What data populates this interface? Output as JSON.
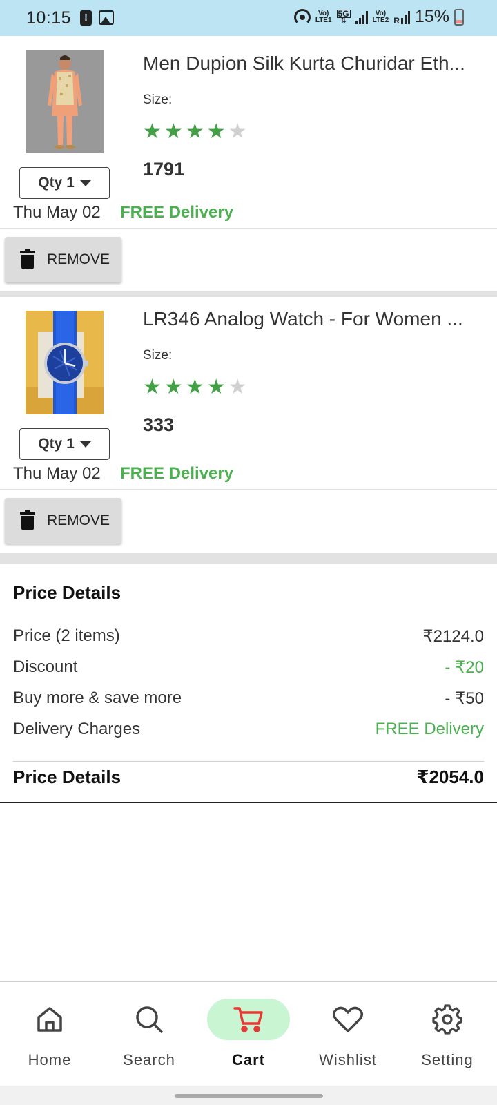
{
  "status_bar": {
    "time": "10:15",
    "battery_pct": "15%",
    "net_5g": "5G",
    "volte1_top": "Vo)",
    "volte1_bottom": "LTE1",
    "volte2_top": "Vo)",
    "volte2_bottom": "LTE2",
    "roam": "R",
    "icons": [
      "alert-icon",
      "image-icon",
      "hotspot-icon",
      "signal-icon",
      "battery-icon"
    ]
  },
  "cart_items": [
    {
      "title": "Men Dupion Silk Kurta Churidar Eth...",
      "size_label": "Size:",
      "rating": 4,
      "rating_max": 5,
      "price": "1791",
      "qty_label": "Qty 1",
      "delivery_date": "Thu May 02",
      "delivery_text": "FREE Delivery",
      "remove_label": "REMOVE"
    },
    {
      "title": "LR346 Analog Watch - For Women ...",
      "size_label": "Size:",
      "rating": 4,
      "rating_max": 5,
      "price": "333",
      "qty_label": "Qty 1",
      "delivery_date": "Thu May 02",
      "delivery_text": "FREE Delivery",
      "remove_label": "REMOVE"
    }
  ],
  "price_details": {
    "heading": "Price Details",
    "rows": [
      {
        "label": "Price (2 items)",
        "value": "₹2124.0"
      },
      {
        "label": "Discount",
        "value": "- ₹20"
      },
      {
        "label": "Buy more & save more",
        "value": "- ₹50"
      },
      {
        "label": "Delivery Charges",
        "value": "FREE Delivery"
      }
    ],
    "total_label": "Price Details",
    "total_value": "₹2054.0"
  },
  "bottom_nav": {
    "items": [
      {
        "label": "Home",
        "icon": "home-icon"
      },
      {
        "label": "Search",
        "icon": "search-icon"
      },
      {
        "label": "Cart",
        "icon": "cart-icon",
        "active": true
      },
      {
        "label": "Wishlist",
        "icon": "heart-icon"
      },
      {
        "label": "Setting",
        "icon": "gear-icon"
      }
    ]
  },
  "colors": {
    "accent_green": "#4caf50",
    "star_green": "#43a047",
    "cart_active_bg": "#c9f5d3",
    "cart_icon_red": "#e53935",
    "status_bar_bg": "#bde4f3"
  }
}
